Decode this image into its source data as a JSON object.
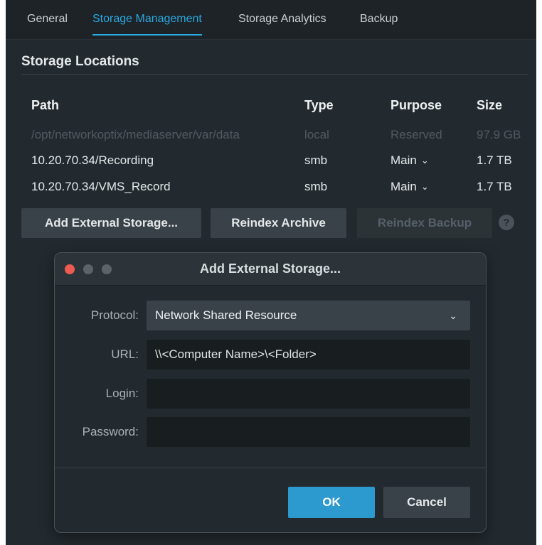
{
  "tabs": [
    "General",
    "Storage Management",
    "Storage Analytics",
    "Backup"
  ],
  "active_tab": "Storage Management",
  "section_title": "Storage Locations",
  "table": {
    "headers": {
      "path": "Path",
      "type": "Type",
      "purpose": "Purpose",
      "size": "Size"
    },
    "rows": [
      {
        "path": "/opt/networkoptix/mediaserver/var/data",
        "type": "local",
        "purpose": "Reserved",
        "size": "97.9 GB",
        "state": "disabled"
      },
      {
        "path": "10.20.70.34/Recording",
        "type": "smb",
        "purpose": "Main",
        "size": "1.7 TB",
        "state": "enabled"
      },
      {
        "path": "10.20.70.34/VMS_Record",
        "type": "smb",
        "purpose": "Main",
        "size": "1.7 TB",
        "state": "enabled"
      }
    ]
  },
  "actions": {
    "add_external": "Add External Storage...",
    "reindex_archive": "Reindex Archive",
    "reindex_backup": "Reindex Backup",
    "help_glyph": "?"
  },
  "dialog": {
    "title": "Add External Storage...",
    "protocol_label": "Protocol:",
    "protocol_value": "Network Shared Resource",
    "url_label": "URL:",
    "url_value": "\\\\<Computer Name>\\<Folder>",
    "login_label": "Login:",
    "login_value": "",
    "password_label": "Password:",
    "password_value": "",
    "ok_label": "OK",
    "cancel_label": "Cancel"
  },
  "colors": {
    "accent": "#2aa9e0",
    "ok_button": "#2c99cf",
    "close_light": "#ec5a52",
    "background": "#232a2f"
  }
}
